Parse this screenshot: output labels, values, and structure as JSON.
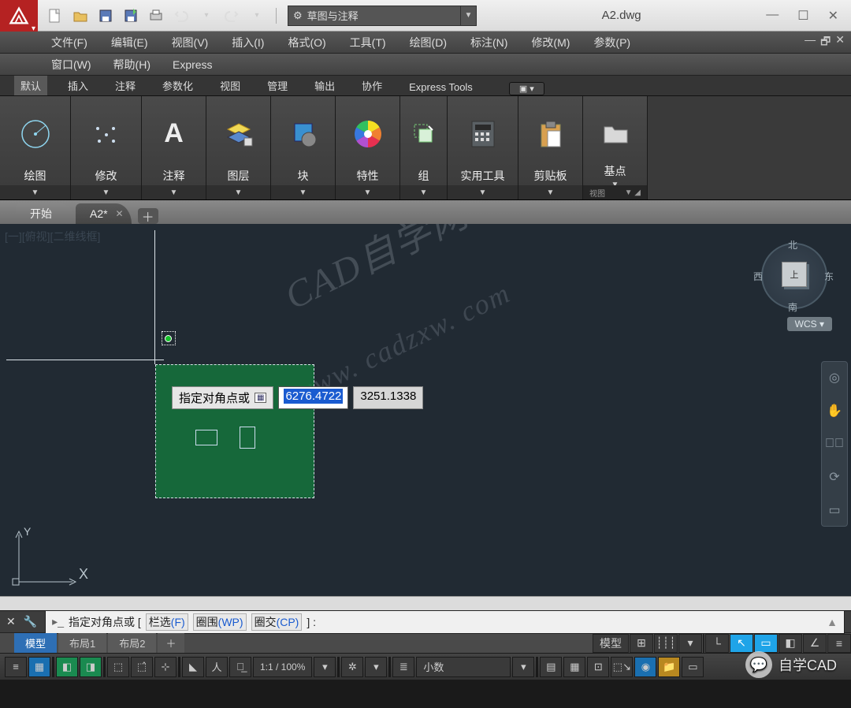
{
  "titlebar": {
    "doc": "A2.dwg",
    "workspace": "草图与注释"
  },
  "menus1": [
    "文件(F)",
    "编辑(E)",
    "视图(V)",
    "插入(I)",
    "格式(O)",
    "工具(T)",
    "绘图(D)",
    "标注(N)",
    "修改(M)",
    "参数(P)"
  ],
  "menus2": [
    "窗口(W)",
    "帮助(H)",
    "Express"
  ],
  "ribbon_tabs": [
    "默认",
    "插入",
    "注释",
    "参数化",
    "视图",
    "管理",
    "输出",
    "协作",
    "Express Tools"
  ],
  "panels": [
    {
      "label": "绘图",
      "icon": "circle"
    },
    {
      "label": "修改",
      "icon": "dots"
    },
    {
      "label": "注释",
      "icon": "A"
    },
    {
      "label": "图层",
      "icon": "layers"
    },
    {
      "label": "块",
      "icon": "block"
    },
    {
      "label": "特性",
      "icon": "wheel"
    },
    {
      "label": "组",
      "icon": "group",
      "nofoot": true
    },
    {
      "label": "实用工具",
      "icon": "calc"
    },
    {
      "label": "剪贴板",
      "icon": "paste"
    },
    {
      "label": "基点",
      "icon": "folder",
      "foot": "视图"
    }
  ],
  "filetabs": {
    "start": "开始",
    "active": "A2*"
  },
  "viewport": {
    "label": "[一][俯视][二维线框]",
    "dirs": {
      "n": "北",
      "s": "南",
      "e": "东",
      "w": "西",
      "top": "上"
    },
    "wcs": "WCS",
    "prompt_label": "指定对角点或",
    "val1": "6276.4722",
    "val2": "3251.1338",
    "ucs_y": "Y",
    "ucs_x": "X"
  },
  "watermark1": "CAD自学网",
  "watermark2": "www. cadzxw. com",
  "cmd": {
    "text": "指定对角点或  [",
    "o1": "栏选",
    "k1": "(F)",
    "o2": "圈围",
    "k2": "(WP)",
    "o3": "圈交",
    "k3": "(CP)",
    "tail": "] :"
  },
  "layout": {
    "model": "模型",
    "l1": "布局1",
    "l2": "布局2",
    "status_model": "模型",
    "precision": "小数"
  },
  "bottom": {
    "scale": "1:1 / 100%"
  },
  "wechat": "自学CAD"
}
